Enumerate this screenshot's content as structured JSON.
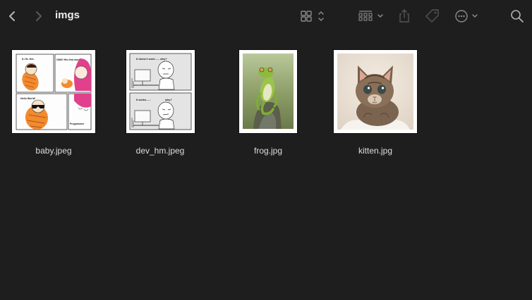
{
  "window": {
    "title": "imgs"
  },
  "toolbar": {
    "back_icon": "chevron-left-icon",
    "forward_icon": "chevron-right-icon",
    "view_icon": "icon-grid-view-icon",
    "group_icon": "group-by-icon",
    "share_icon": "share-icon",
    "tag_icon": "tag-icon",
    "action_icon": "ellipsis-circle-icon",
    "search_icon": "search-icon"
  },
  "files": [
    {
      "name": "baby.jpeg"
    },
    {
      "name": "dev_hm.jpeg"
    },
    {
      "name": "frog.jpg"
    },
    {
      "name": "kitten.jpg"
    }
  ],
  "comic": {
    "baby": [
      "It..He..Hel..",
      "OMG! His first words.",
      "Hello World!",
      "Programmer"
    ],
    "dev": [
      "It doesn't work...... why?",
      "It works......",
      "why?"
    ]
  },
  "colors": {
    "background": "#1e1e1e",
    "text": "#dedede",
    "icon": "#8a8a8a"
  }
}
